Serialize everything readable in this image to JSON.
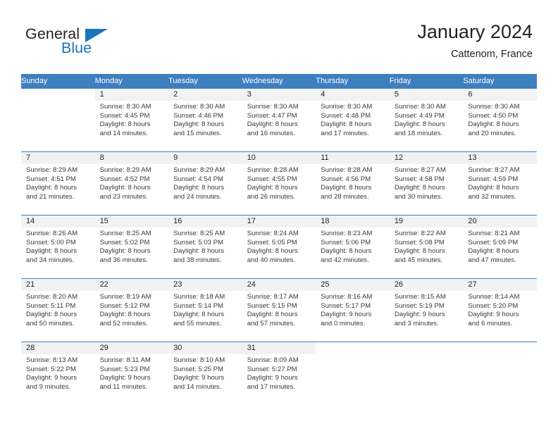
{
  "logo": {
    "word_one": "General",
    "word_two": "Blue",
    "triangle_color": "#1b75bb"
  },
  "header": {
    "title": "January 2024",
    "subtitle": "Cattenom, France"
  },
  "theme": {
    "header_blue": "#3e7fbf",
    "daynum_band": "#f2f2f2",
    "text": "#231f20",
    "body_text": "#3a3a3a"
  },
  "weekday_headers": [
    "Sunday",
    "Monday",
    "Tuesday",
    "Wednesday",
    "Thursday",
    "Friday",
    "Saturday"
  ],
  "weeks": [
    [
      {
        "day": "",
        "lines": []
      },
      {
        "day": "1",
        "lines": [
          "Sunrise: 8:30 AM",
          "Sunset: 4:45 PM",
          "Daylight: 8 hours",
          "and 14 minutes."
        ]
      },
      {
        "day": "2",
        "lines": [
          "Sunrise: 8:30 AM",
          "Sunset: 4:46 PM",
          "Daylight: 8 hours",
          "and 15 minutes."
        ]
      },
      {
        "day": "3",
        "lines": [
          "Sunrise: 8:30 AM",
          "Sunset: 4:47 PM",
          "Daylight: 8 hours",
          "and 16 minutes."
        ]
      },
      {
        "day": "4",
        "lines": [
          "Sunrise: 8:30 AM",
          "Sunset: 4:48 PM",
          "Daylight: 8 hours",
          "and 17 minutes."
        ]
      },
      {
        "day": "5",
        "lines": [
          "Sunrise: 8:30 AM",
          "Sunset: 4:49 PM",
          "Daylight: 8 hours",
          "and 18 minutes."
        ]
      },
      {
        "day": "6",
        "lines": [
          "Sunrise: 8:30 AM",
          "Sunset: 4:50 PM",
          "Daylight: 8 hours",
          "and 20 minutes."
        ]
      }
    ],
    [
      {
        "day": "7",
        "lines": [
          "Sunrise: 8:29 AM",
          "Sunset: 4:51 PM",
          "Daylight: 8 hours",
          "and 21 minutes."
        ]
      },
      {
        "day": "8",
        "lines": [
          "Sunrise: 8:29 AM",
          "Sunset: 4:52 PM",
          "Daylight: 8 hours",
          "and 23 minutes."
        ]
      },
      {
        "day": "9",
        "lines": [
          "Sunrise: 8:29 AM",
          "Sunset: 4:54 PM",
          "Daylight: 8 hours",
          "and 24 minutes."
        ]
      },
      {
        "day": "10",
        "lines": [
          "Sunrise: 8:28 AM",
          "Sunset: 4:55 PM",
          "Daylight: 8 hours",
          "and 26 minutes."
        ]
      },
      {
        "day": "11",
        "lines": [
          "Sunrise: 8:28 AM",
          "Sunset: 4:56 PM",
          "Daylight: 8 hours",
          "and 28 minutes."
        ]
      },
      {
        "day": "12",
        "lines": [
          "Sunrise: 8:27 AM",
          "Sunset: 4:58 PM",
          "Daylight: 8 hours",
          "and 30 minutes."
        ]
      },
      {
        "day": "13",
        "lines": [
          "Sunrise: 8:27 AM",
          "Sunset: 4:59 PM",
          "Daylight: 8 hours",
          "and 32 minutes."
        ]
      }
    ],
    [
      {
        "day": "14",
        "lines": [
          "Sunrise: 8:26 AM",
          "Sunset: 5:00 PM",
          "Daylight: 8 hours",
          "and 34 minutes."
        ]
      },
      {
        "day": "15",
        "lines": [
          "Sunrise: 8:25 AM",
          "Sunset: 5:02 PM",
          "Daylight: 8 hours",
          "and 36 minutes."
        ]
      },
      {
        "day": "16",
        "lines": [
          "Sunrise: 8:25 AM",
          "Sunset: 5:03 PM",
          "Daylight: 8 hours",
          "and 38 minutes."
        ]
      },
      {
        "day": "17",
        "lines": [
          "Sunrise: 8:24 AM",
          "Sunset: 5:05 PM",
          "Daylight: 8 hours",
          "and 40 minutes."
        ]
      },
      {
        "day": "18",
        "lines": [
          "Sunrise: 8:23 AM",
          "Sunset: 5:06 PM",
          "Daylight: 8 hours",
          "and 42 minutes."
        ]
      },
      {
        "day": "19",
        "lines": [
          "Sunrise: 8:22 AM",
          "Sunset: 5:08 PM",
          "Daylight: 8 hours",
          "and 45 minutes."
        ]
      },
      {
        "day": "20",
        "lines": [
          "Sunrise: 8:21 AM",
          "Sunset: 5:09 PM",
          "Daylight: 8 hours",
          "and 47 minutes."
        ]
      }
    ],
    [
      {
        "day": "21",
        "lines": [
          "Sunrise: 8:20 AM",
          "Sunset: 5:11 PM",
          "Daylight: 8 hours",
          "and 50 minutes."
        ]
      },
      {
        "day": "22",
        "lines": [
          "Sunrise: 8:19 AM",
          "Sunset: 5:12 PM",
          "Daylight: 8 hours",
          "and 52 minutes."
        ]
      },
      {
        "day": "23",
        "lines": [
          "Sunrise: 8:18 AM",
          "Sunset: 5:14 PM",
          "Daylight: 8 hours",
          "and 55 minutes."
        ]
      },
      {
        "day": "24",
        "lines": [
          "Sunrise: 8:17 AM",
          "Sunset: 5:15 PM",
          "Daylight: 8 hours",
          "and 57 minutes."
        ]
      },
      {
        "day": "25",
        "lines": [
          "Sunrise: 8:16 AM",
          "Sunset: 5:17 PM",
          "Daylight: 9 hours",
          "and 0 minutes."
        ]
      },
      {
        "day": "26",
        "lines": [
          "Sunrise: 8:15 AM",
          "Sunset: 5:19 PM",
          "Daylight: 9 hours",
          "and 3 minutes."
        ]
      },
      {
        "day": "27",
        "lines": [
          "Sunrise: 8:14 AM",
          "Sunset: 5:20 PM",
          "Daylight: 9 hours",
          "and 6 minutes."
        ]
      }
    ],
    [
      {
        "day": "28",
        "lines": [
          "Sunrise: 8:13 AM",
          "Sunset: 5:22 PM",
          "Daylight: 9 hours",
          "and 9 minutes."
        ]
      },
      {
        "day": "29",
        "lines": [
          "Sunrise: 8:11 AM",
          "Sunset: 5:23 PM",
          "Daylight: 9 hours",
          "and 11 minutes."
        ]
      },
      {
        "day": "30",
        "lines": [
          "Sunrise: 8:10 AM",
          "Sunset: 5:25 PM",
          "Daylight: 9 hours",
          "and 14 minutes."
        ]
      },
      {
        "day": "31",
        "lines": [
          "Sunrise: 8:09 AM",
          "Sunset: 5:27 PM",
          "Daylight: 9 hours",
          "and 17 minutes."
        ]
      },
      {
        "day": "",
        "lines": []
      },
      {
        "day": "",
        "lines": []
      },
      {
        "day": "",
        "lines": []
      }
    ]
  ]
}
